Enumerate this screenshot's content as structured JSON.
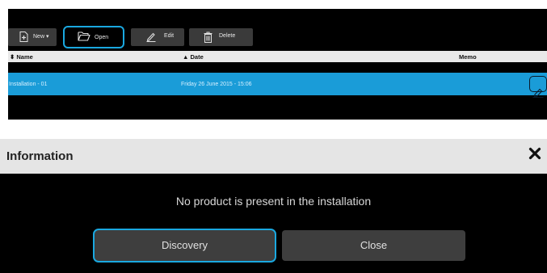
{
  "toolbar": {
    "new_label": "New ▾",
    "open_label": "Open",
    "edit_label": "Edit",
    "delete_label": "Delete"
  },
  "table": {
    "columns": {
      "name": "⬍ Name",
      "date": "▲ Date",
      "memo": "Memo"
    },
    "rows": [
      {
        "name": "Installation - 01",
        "date": "Friday 26 June 2015 - 15:06"
      }
    ]
  },
  "dialog": {
    "title": "Information",
    "close_glyph": "✖",
    "message": "No product is present in the installation",
    "discovery_label": "Discovery",
    "close_label": "Close"
  },
  "colors": {
    "accent": "#1aa8e0",
    "selected_row": "#1a9cd8",
    "panel_bg": "#000000",
    "button_bg": "#3e3e3e"
  },
  "icons": [
    "new-file-icon",
    "open-folder-icon",
    "edit-pencil-icon",
    "trash-icon",
    "memo-edit-icon",
    "close-icon"
  ]
}
